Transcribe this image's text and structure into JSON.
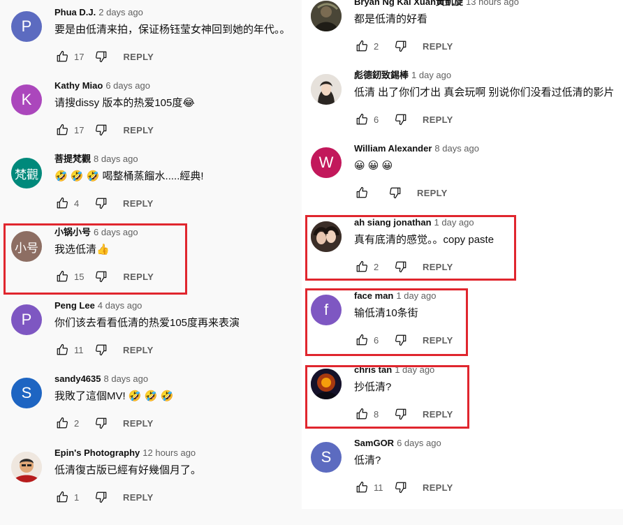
{
  "ui": {
    "reply_label": "REPLY"
  },
  "left_comments": [
    {
      "author": "Phua D.J.",
      "time": "2 days ago",
      "text": "要是由低清来拍，保证杨钰莹女神回到她的年代。。",
      "likes": "17",
      "avatar_letter": "P",
      "avatar_color": "#5c6bc0"
    },
    {
      "author": "Kathy Miao",
      "time": "6 days ago",
      "text": "请搜dissy 版本的热爱105度😂",
      "likes": "17",
      "avatar_letter": "K",
      "avatar_color": "#ab47bc"
    },
    {
      "author": "菩提梵觀",
      "time": "8 days ago",
      "text": "🤣 🤣 🤣 喝整桶蒸餾水.....經典!",
      "likes": "4",
      "avatar_letter": "梵觀",
      "avatar_color": "#00897b"
    },
    {
      "author": "小锅小号",
      "time": "6 days ago",
      "text": "我选低清👍",
      "likes": "15",
      "avatar_letter": "小号",
      "avatar_color": "#8d6e63"
    },
    {
      "author": "Peng Lee",
      "time": "4 days ago",
      "text": "你们该去看看低清的热爱105度再来表演",
      "likes": "11",
      "avatar_letter": "P",
      "avatar_color": "#7e57c2"
    },
    {
      "author": "sandy4635",
      "time": "8 days ago",
      "text": "我敗了這個MV! 🤣 🤣 🤣",
      "likes": "2",
      "avatar_letter": "S",
      "avatar_color": "#1e65c2"
    },
    {
      "author": "Epin's Photography",
      "time": "12 hours ago",
      "text": "低清復古版已經有好幾個月了。",
      "likes": "1",
      "avatar_letter": "",
      "avatar_color": "#c62828"
    }
  ],
  "right_comments": [
    {
      "author": "Bryan Ng Kai Xuan黃凱旋",
      "time": "13 hours ago",
      "text": "都是低清的好看",
      "likes": "2",
      "avatar_letter": "",
      "avatar_color": "#3e3b32"
    },
    {
      "author": "彪德釰致錫棒",
      "time": "1 day ago",
      "text": "低清 出了你们才出 真会玩啊 别说你们没看过低清的影片",
      "likes": "6",
      "avatar_letter": "",
      "avatar_color": "#bdbdbd"
    },
    {
      "author": "William Alexander",
      "time": "8 days ago",
      "text": "😀 😀 😀",
      "likes": "",
      "avatar_letter": "W",
      "avatar_color": "#c2185b"
    },
    {
      "author": "ah siang jonathan",
      "time": "1 day ago",
      "text": "真有底清的感觉。。copy paste",
      "likes": "2",
      "avatar_letter": "",
      "avatar_color": "#5d4037"
    },
    {
      "author": "face man",
      "time": "1 day ago",
      "text": "输低清10条街",
      "likes": "6",
      "avatar_letter": "f",
      "avatar_color": "#7e57c2"
    },
    {
      "author": "chris tan",
      "time": "1 day ago",
      "text": "抄低清?",
      "likes": "8",
      "avatar_letter": "",
      "avatar_color": "#1a1a2e"
    },
    {
      "author": "SamGOR",
      "time": "6 days ago",
      "text": "低清?",
      "likes": "11",
      "avatar_letter": "S",
      "avatar_color": "#5c6bc0"
    }
  ]
}
